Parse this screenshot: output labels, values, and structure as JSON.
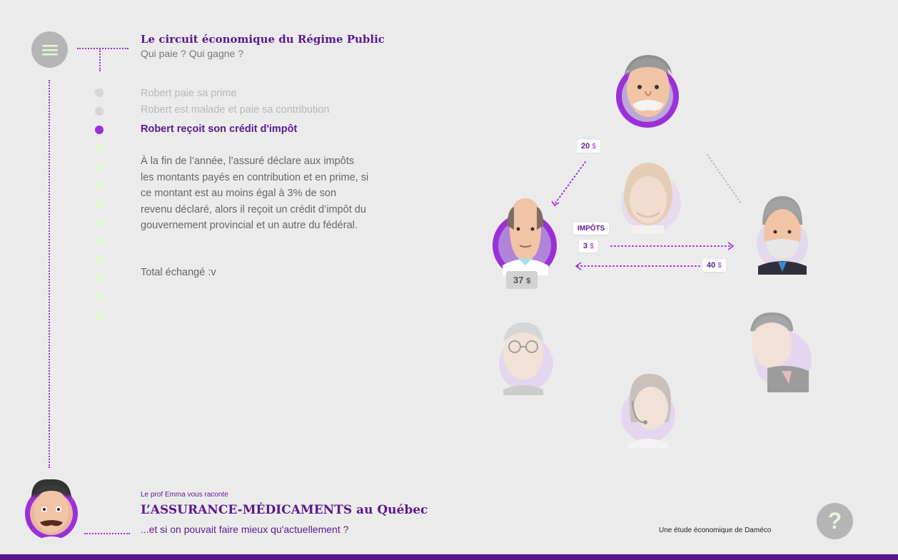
{
  "header": {
    "title": "Le circuit économique du Régime Public",
    "subtitle": "Qui paie ? Qui gagne ?"
  },
  "menu": {
    "icon": "hamburger-icon"
  },
  "steps": [
    {
      "label": "Robert paie sa prime",
      "state": "done"
    },
    {
      "label": "Robert est malade et paie sa contribution",
      "state": "done"
    },
    {
      "label": "Robert reçoit son crédit d'impôt",
      "state": "active"
    },
    {
      "label": "",
      "state": "todo"
    },
    {
      "label": "",
      "state": "todo"
    },
    {
      "label": "",
      "state": "todo"
    },
    {
      "label": "",
      "state": "todo"
    },
    {
      "label": "",
      "state": "todo"
    },
    {
      "label": "",
      "state": "todo"
    },
    {
      "label": "",
      "state": "todo"
    },
    {
      "label": "",
      "state": "todo"
    },
    {
      "label": "",
      "state": "todo"
    },
    {
      "label": "",
      "state": "todo"
    }
  ],
  "description": "À la fin de l’année, l’assuré déclare aux impôts les montants payés en contribution et en prime, si ce montant est au moins égal à 3% de son revenu déclaré, alors il reçoit un crédit d’impôt du gouvernement provincial et un autre du fédéral.",
  "total": "Total échangé :v",
  "diagram": {
    "flow_20": {
      "amount": "20",
      "currency": "$"
    },
    "impots_label": "IMPÔTS",
    "flow_3": {
      "amount": "3",
      "currency": "$"
    },
    "flow_40": {
      "amount": "40",
      "currency": "$"
    },
    "robert_balance": {
      "amount": "37",
      "currency": "$"
    }
  },
  "footer": {
    "presenter": "Le prof Emma vous raconte",
    "title": "L’ASSURANCE-MÉDICAMENTS au Québec",
    "tagline": "...et si on pouvait faire mieux qu'actuellement ?",
    "credit": "Une étude économique de Daméco",
    "help_label": "?"
  },
  "colors": {
    "accent": "#9b30d9",
    "brand_dark": "#5a1a8c",
    "todo_dot": "#def5cf",
    "background": "#ebebeb"
  }
}
